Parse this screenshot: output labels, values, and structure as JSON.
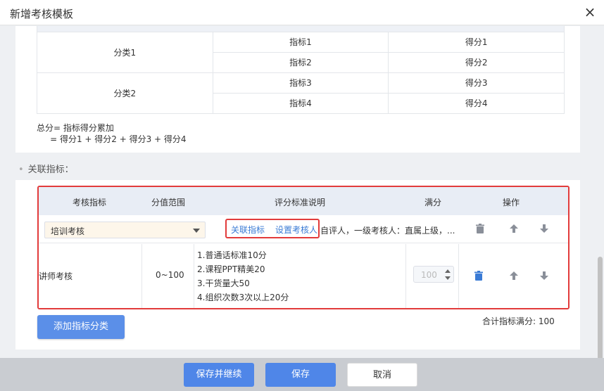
{
  "dialog": {
    "title": "新增考核模板",
    "close_glyph": "×"
  },
  "grid": {
    "rows": [
      {
        "category": "分类1",
        "metric": "指标1",
        "score": "得分1"
      },
      {
        "category": "",
        "metric": "指标2",
        "score": "得分2"
      },
      {
        "category": "分类2",
        "metric": "指标3",
        "score": "得分3"
      },
      {
        "category": "",
        "metric": "指标4",
        "score": "得分4"
      }
    ],
    "formula_line1": "总分= 指标得分累加",
    "formula_line2": "     = 得分1 + 得分2 + 得分3 + 得分4"
  },
  "section": {
    "label": "关联指标："
  },
  "table": {
    "headers": {
      "metric": "考核指标",
      "range": "分值范围",
      "criteria": "评分标准说明",
      "full": "满分",
      "ops": "操作"
    },
    "row1": {
      "select_value": "培训考核",
      "link_related": "关联指标",
      "link_reviewer": "设置考核人",
      "description": "自评人，一级考核人：直属上级，..."
    },
    "row2": {
      "name": "讲师考核",
      "range": "0~100",
      "criteria": "1.普通话标准10分\n2.课程PPT精美20\n3.干货量大50\n4.组织次数3次以上20分",
      "full_score": "100"
    }
  },
  "add_button": "添加指标分类",
  "total_label": "合计指标满分:  100",
  "footer": {
    "save_continue": "保存并继续",
    "save": "保存",
    "cancel": "取消"
  },
  "colors": {
    "accent": "#4f86e8",
    "highlight": "#e23b3b",
    "link": "#3a7bd5"
  },
  "icons": [
    "close-icon",
    "caret-down-icon",
    "trash-icon",
    "arrow-up-icon",
    "arrow-down-icon"
  ]
}
